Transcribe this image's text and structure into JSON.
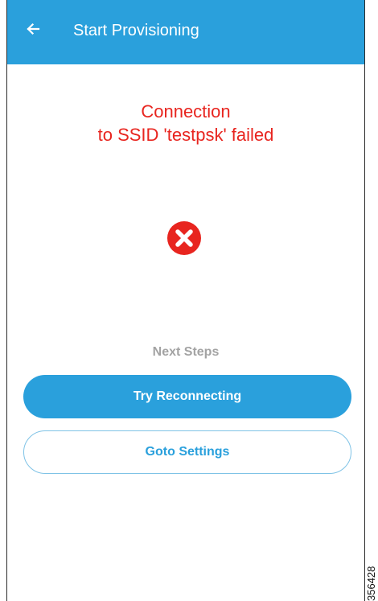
{
  "header": {
    "back_icon": "arrow-left-icon",
    "title": "Start Provisioning",
    "background_color": "#2aa0dc"
  },
  "status": {
    "line1": "Connection",
    "line2": "to SSID 'testpsk' failed",
    "color": "#e8251f",
    "icon": "error-x-circle-icon"
  },
  "next_steps": {
    "heading": "Next Steps"
  },
  "actions": {
    "primary_label": "Try Reconnecting",
    "secondary_label": "Goto Settings"
  },
  "figure_id": "356428"
}
